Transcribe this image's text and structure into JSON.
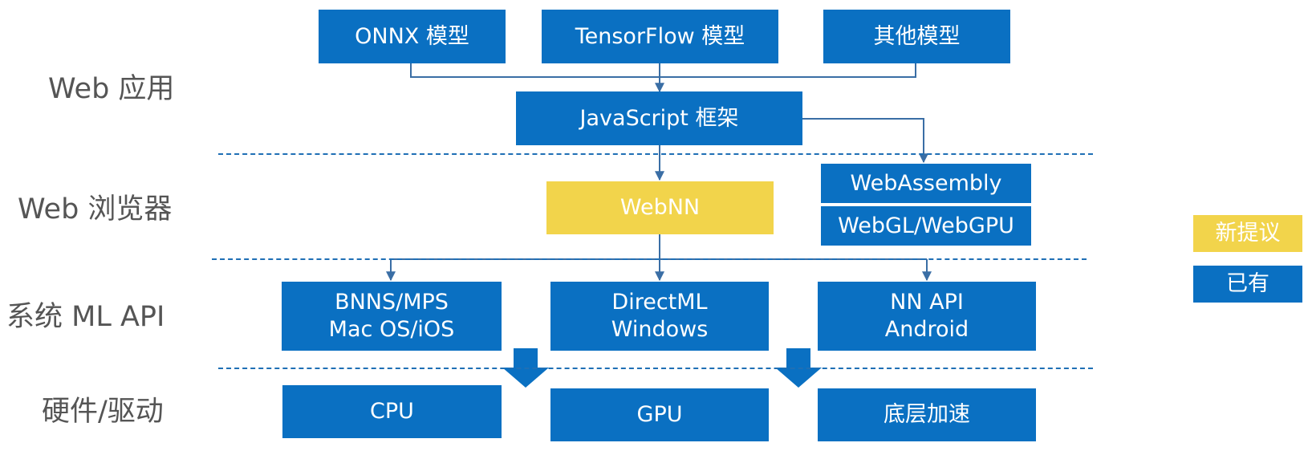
{
  "layers": {
    "web_app": "Web 应用",
    "web_browser": "Web 浏览器",
    "system_ml_api": "系统 ML API",
    "hardware_driver": "硬件/驱动"
  },
  "boxes": {
    "onnx": "ONNX 模型",
    "tensorflow": "TensorFlow 模型",
    "other_models": "其他模型",
    "javascript": "JavaScript 框架",
    "webnn": "WebNN",
    "webassembly": "WebAssembly",
    "webgl": "WebGL/WebGPU",
    "bnns": {
      "line1": "BNNS/MPS",
      "line2": "Mac OS/iOS"
    },
    "directml": {
      "line1": "DirectML",
      "line2": "Windows"
    },
    "nnapi": {
      "line1": "NN API",
      "line2": "Android"
    },
    "cpu": "CPU",
    "gpu": "GPU",
    "accel": "底层加速"
  },
  "legend": {
    "new_proposal": "新提议",
    "existing": "已有"
  },
  "colors": {
    "existing": "#0a70c2",
    "new_proposal": "#f2d44b",
    "connector": "#3a6ea5",
    "label": "#555555"
  }
}
